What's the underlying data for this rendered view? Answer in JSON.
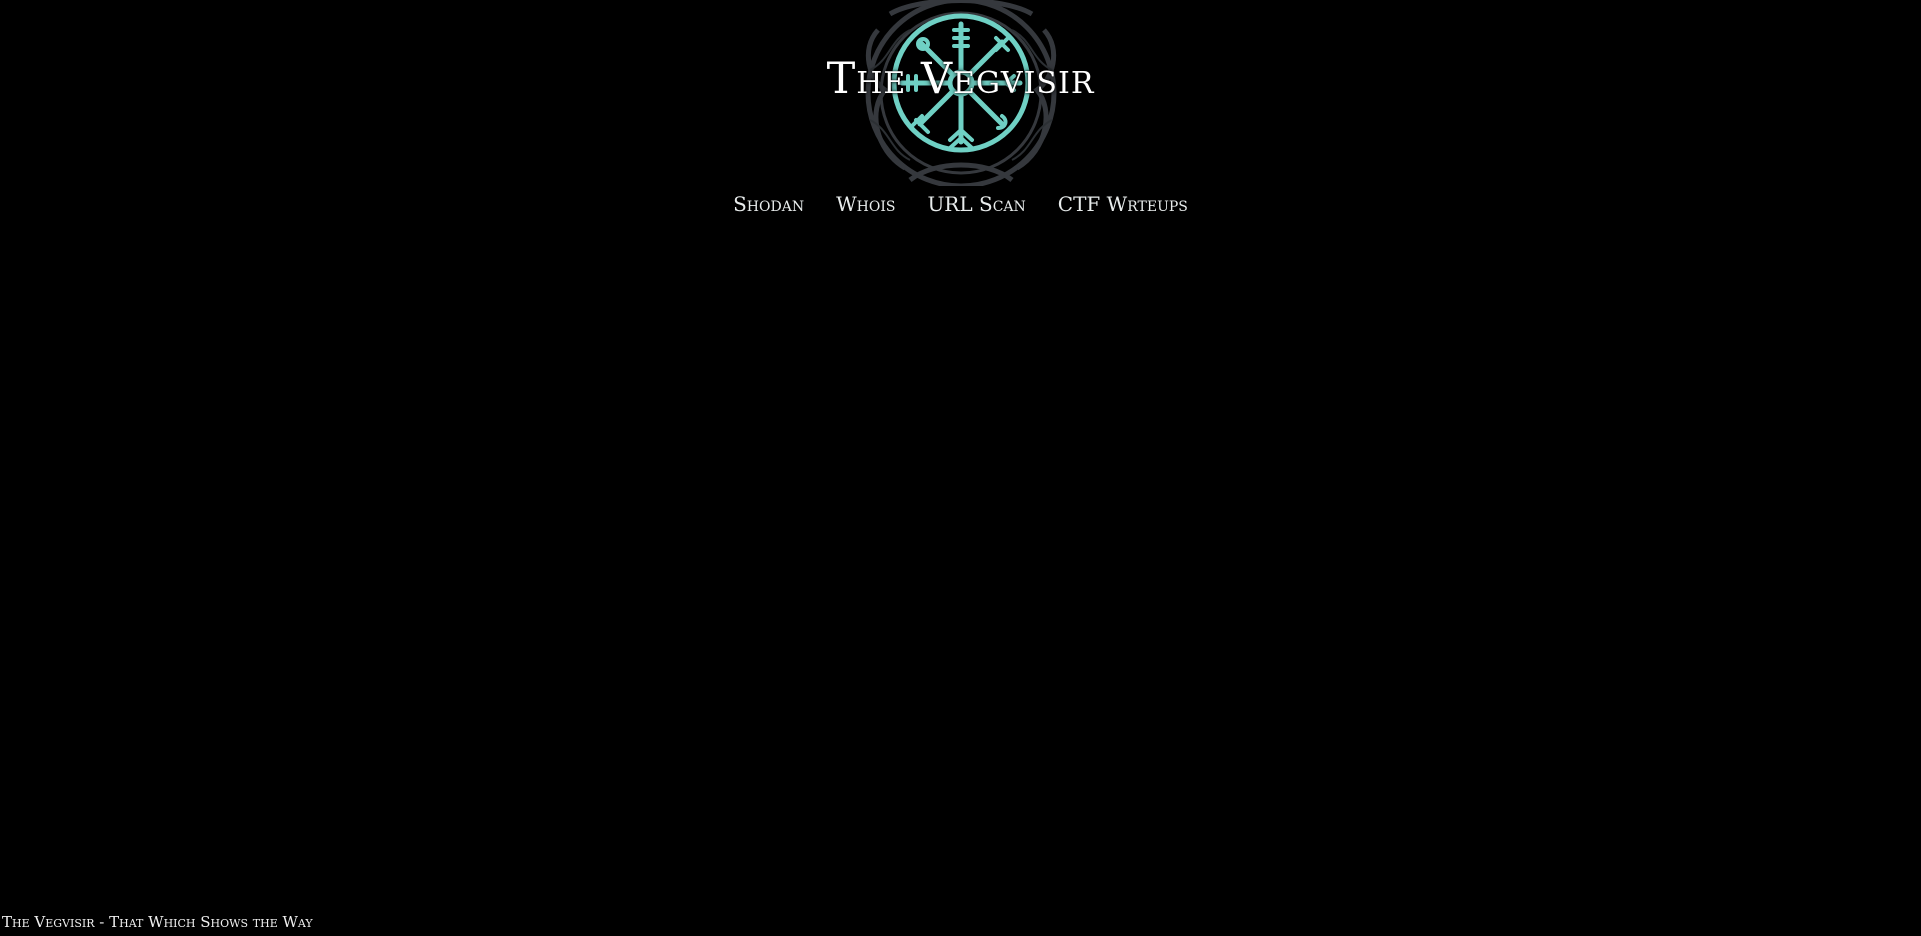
{
  "header": {
    "title": "The Vegvisir",
    "emblem_icon": "vegvisir-compass-icon",
    "emblem_color": "#6fd0c4"
  },
  "nav": {
    "items": [
      {
        "label": "Shodan"
      },
      {
        "label": "Whois"
      },
      {
        "label": "URL Scan"
      },
      {
        "label": "CTF Wrteups"
      }
    ]
  },
  "footer": {
    "text": "The Vegvisir - That Which Shows the Way"
  },
  "colors": {
    "background": "#000000",
    "text": "#ffffff",
    "accent": "#6fd0c4"
  }
}
